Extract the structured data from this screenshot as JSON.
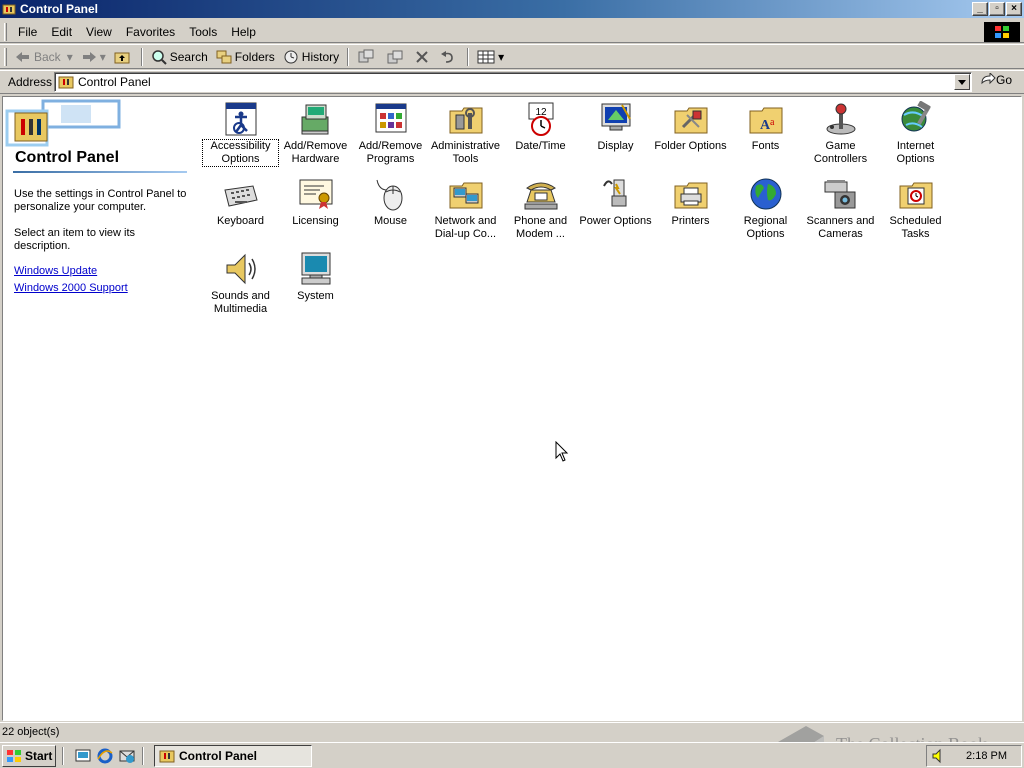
{
  "window": {
    "title": "Control Panel"
  },
  "menu": [
    "File",
    "Edit",
    "View",
    "Favorites",
    "Tools",
    "Help"
  ],
  "toolbar": {
    "back": "Back",
    "search": "Search",
    "folders": "Folders",
    "history": "History"
  },
  "address": {
    "label": "Address",
    "value": "Control Panel",
    "go": "Go"
  },
  "left_pane": {
    "title": "Control Panel",
    "desc1": "Use the settings in Control Panel to personalize your computer.",
    "desc2": "Select an item to view its description.",
    "link1": "Windows Update",
    "link2": "Windows 2000 Support"
  },
  "icons": [
    {
      "label": "Accessibility Options",
      "icon": "accessibility-icon"
    },
    {
      "label": "Add/Remove Hardware",
      "icon": "hardware-icon"
    },
    {
      "label": "Add/Remove Programs",
      "icon": "programs-icon"
    },
    {
      "label": "Administrative Tools",
      "icon": "admin-tools-icon"
    },
    {
      "label": "Date/Time",
      "icon": "datetime-icon"
    },
    {
      "label": "Display",
      "icon": "display-icon"
    },
    {
      "label": "Folder Options",
      "icon": "folder-options-icon"
    },
    {
      "label": "Fonts",
      "icon": "fonts-icon"
    },
    {
      "label": "Game Controllers",
      "icon": "joystick-icon"
    },
    {
      "label": "Internet Options",
      "icon": "internet-icon"
    },
    {
      "label": "Keyboard",
      "icon": "keyboard-icon"
    },
    {
      "label": "Licensing",
      "icon": "certificate-icon"
    },
    {
      "label": "Mouse",
      "icon": "mouse-icon"
    },
    {
      "label": "Network and Dial-up Co...",
      "icon": "network-icon"
    },
    {
      "label": "Phone and Modem ...",
      "icon": "phone-icon"
    },
    {
      "label": "Power Options",
      "icon": "power-icon"
    },
    {
      "label": "Printers",
      "icon": "printer-icon"
    },
    {
      "label": "Regional Options",
      "icon": "globe-icon"
    },
    {
      "label": "Scanners and Cameras",
      "icon": "scanner-icon"
    },
    {
      "label": "Scheduled Tasks",
      "icon": "tasks-icon"
    },
    {
      "label": "Sounds and Multimedia",
      "icon": "speaker-icon"
    },
    {
      "label": "System",
      "icon": "computer-icon"
    }
  ],
  "status": {
    "text": "22 object(s)"
  },
  "taskbar": {
    "start": "Start",
    "task": "Control Panel",
    "clock": "2:18 PM"
  },
  "watermark": "The Collection Book"
}
